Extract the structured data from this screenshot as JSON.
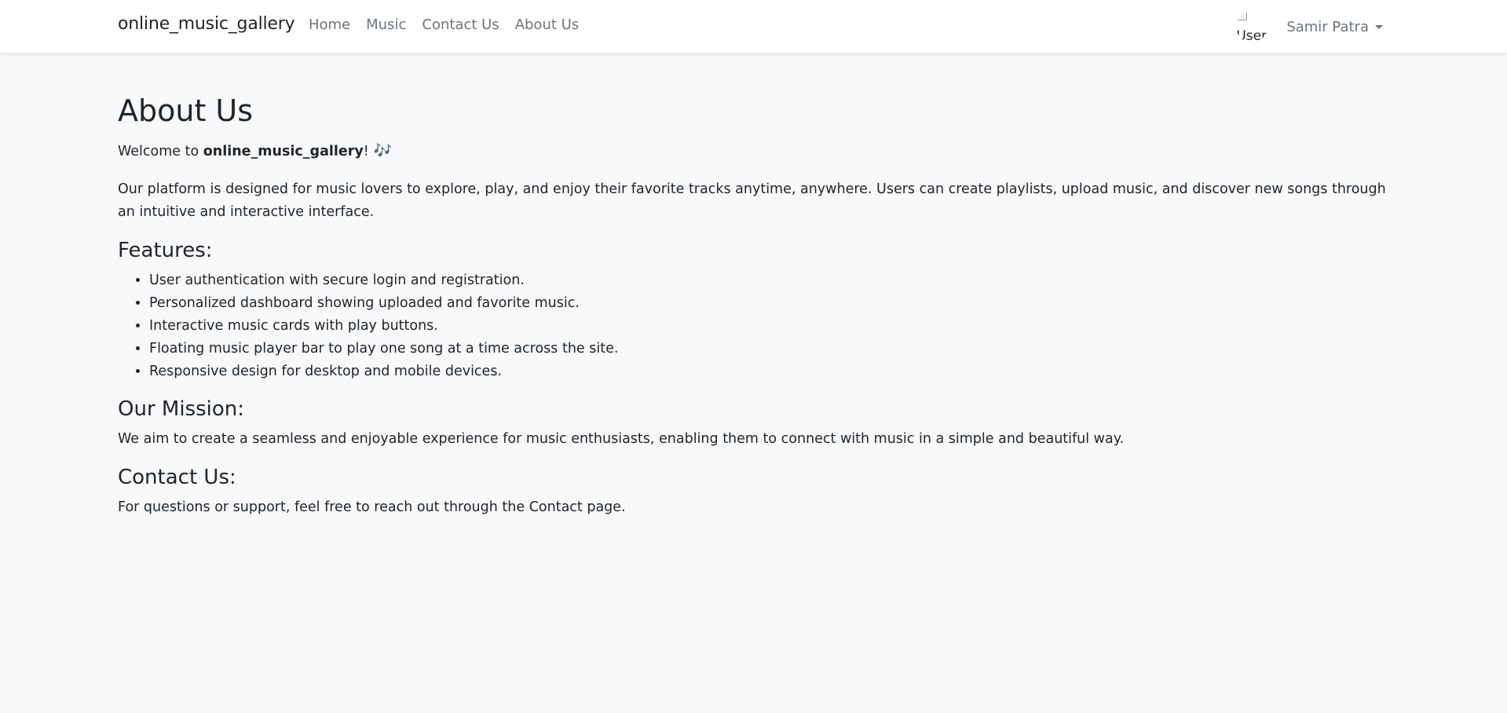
{
  "navbar": {
    "brand": "online_music_gallery",
    "links": [
      "Home",
      "Music",
      "Contact Us",
      "About Us"
    ],
    "avatar_alt": "User",
    "user_name": "Samir Patra"
  },
  "about": {
    "title": "About Us",
    "welcome_prefix": "Welcome to ",
    "welcome_brand": "online_music_gallery",
    "welcome_suffix": "!",
    "music_icon": "music-notes-icon",
    "intro": "Our platform is designed for music lovers to explore, play, and enjoy their favorite tracks anytime, anywhere. Users can create playlists, upload music, and discover new songs through an intuitive and interactive interface.",
    "features_title": "Features:",
    "features": [
      "User authentication with secure login and registration.",
      "Personalized dashboard showing uploaded and favorite music.",
      "Interactive music cards with play buttons.",
      "Floating music player bar to play one song at a time across the site.",
      "Responsive design for desktop and mobile devices."
    ],
    "mission_title": "Our Mission:",
    "mission_text": "We aim to create a seamless and enjoyable experience for music enthusiasts, enabling them to connect with music in a simple and beautiful way.",
    "contact_title": "Contact Us:",
    "contact_text": "For questions or support, feel free to reach out through the Contact page."
  },
  "colors": {
    "page_background": "#f8f9fa",
    "navbar_background": "#ffffff",
    "link_color": "#6c757d",
    "text_color": "#212529",
    "icon_accent": "#6f5bd6"
  }
}
